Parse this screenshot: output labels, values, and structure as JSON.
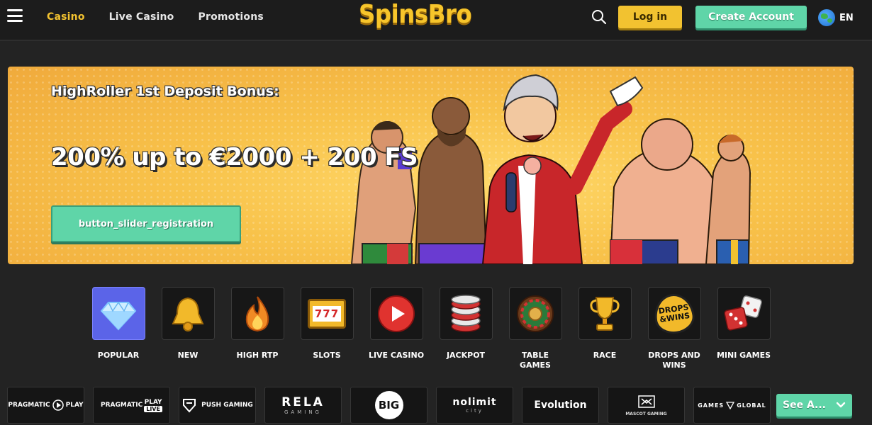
{
  "header": {
    "nav": [
      {
        "label": "Casino",
        "active": true
      },
      {
        "label": "Live Casino",
        "active": false
      },
      {
        "label": "Promotions",
        "active": false
      }
    ],
    "logo": "SpinsBro",
    "login_label": "Log in",
    "create_label": "Create Account",
    "language": "EN"
  },
  "banner": {
    "title": "HighRoller 1st Deposit Bonus:",
    "offer": "200% up to €2000 + 200 FS",
    "button_label": "button_slider_registration"
  },
  "categories": [
    {
      "label": "POPULAR",
      "icon": "diamond-icon",
      "active": true
    },
    {
      "label": "NEW",
      "icon": "bell-icon"
    },
    {
      "label": "HIGH RTP",
      "icon": "fire-icon"
    },
    {
      "label": "SLOTS",
      "icon": "slot-777-icon",
      "glyph": "777"
    },
    {
      "label": "LIVE CASINO",
      "icon": "play-icon"
    },
    {
      "label": "JACKPOT",
      "icon": "chips-icon"
    },
    {
      "label": "TABLE GAMES",
      "icon": "roulette-icon"
    },
    {
      "label": "RACE",
      "icon": "trophy-icon"
    },
    {
      "label": "DROPS AND WINS",
      "icon": "drops-wins-icon",
      "glyph_top": "DROPS",
      "glyph_bottom": "&WINS"
    },
    {
      "label": "MINI GAMES",
      "icon": "dice-icon"
    }
  ],
  "providers": [
    {
      "name": "PRAGMATIC PLAY",
      "line1": "PRAGMATIC",
      "line2": "PLAY"
    },
    {
      "name": "PRAGMATIC PLAY LIVE",
      "line1": "PRAGMATIC",
      "line2": "PLAY",
      "line3": "LIVE"
    },
    {
      "name": "PUSH GAMING",
      "line1": "PUSH GAMING"
    },
    {
      "name": "RELAX GAMING",
      "line1": "RELA",
      "line2": "GAMING"
    },
    {
      "name": "BIG",
      "line1": "BIG"
    },
    {
      "name": "NOLIMIT CITY",
      "line1": "nolimit",
      "line2": "city"
    },
    {
      "name": "Evolution",
      "line1": "Evolution"
    },
    {
      "name": "MASCOT GAMING",
      "line1": "MASCOT",
      "line2": "MASCOT GAMING"
    },
    {
      "name": "GAMES GLOBAL",
      "line1": "GAMES",
      "line2": "GLOBAL"
    }
  ],
  "see_all_label": "See A..."
}
